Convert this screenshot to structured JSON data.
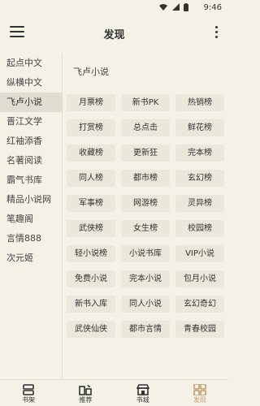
{
  "status": {
    "time": "9:46"
  },
  "app_bar": {
    "title": "发现"
  },
  "sidebar": {
    "items": [
      {
        "label": "起点中文"
      },
      {
        "label": "纵横中文"
      },
      {
        "label": "飞卢小说"
      },
      {
        "label": "晋江文学"
      },
      {
        "label": "红袖添香"
      },
      {
        "label": "名著阅读"
      },
      {
        "label": "霸气书库"
      },
      {
        "label": "精品小说网"
      },
      {
        "label": "笔趣阁"
      },
      {
        "label": "言情888"
      },
      {
        "label": "次元姬"
      }
    ],
    "active_index": 2
  },
  "main": {
    "section_title": "飞卢小说",
    "tags": [
      "月票榜",
      "新书PK",
      "热销榜",
      "打赏榜",
      "总点击",
      "鲜花榜",
      "收藏榜",
      "更新狂",
      "完本榜",
      "同人榜",
      "都市榜",
      "玄幻榜",
      "军事榜",
      "网游榜",
      "灵异榜",
      "武侠榜",
      "女生榜",
      "校园榜",
      "轻小说榜",
      "小说书库",
      "VIP小说",
      "免费小说",
      "完本小说",
      "包月小说",
      "新书入库",
      "同人小说",
      "玄幻奇幻",
      "武侠仙侠",
      "都市言情",
      "青春校园"
    ]
  },
  "tabbar": {
    "tabs": [
      {
        "label": "书架",
        "icon": "bookshelf-icon"
      },
      {
        "label": "推荐",
        "icon": "recommend-icon"
      },
      {
        "label": "书城",
        "icon": "bookstore-icon"
      },
      {
        "label": "发现",
        "icon": "discover-icon",
        "active": true
      }
    ]
  },
  "colors": {
    "accent": "#c79a6e",
    "background": "#f4f1e6",
    "tag_bg": "#ebe7db"
  }
}
